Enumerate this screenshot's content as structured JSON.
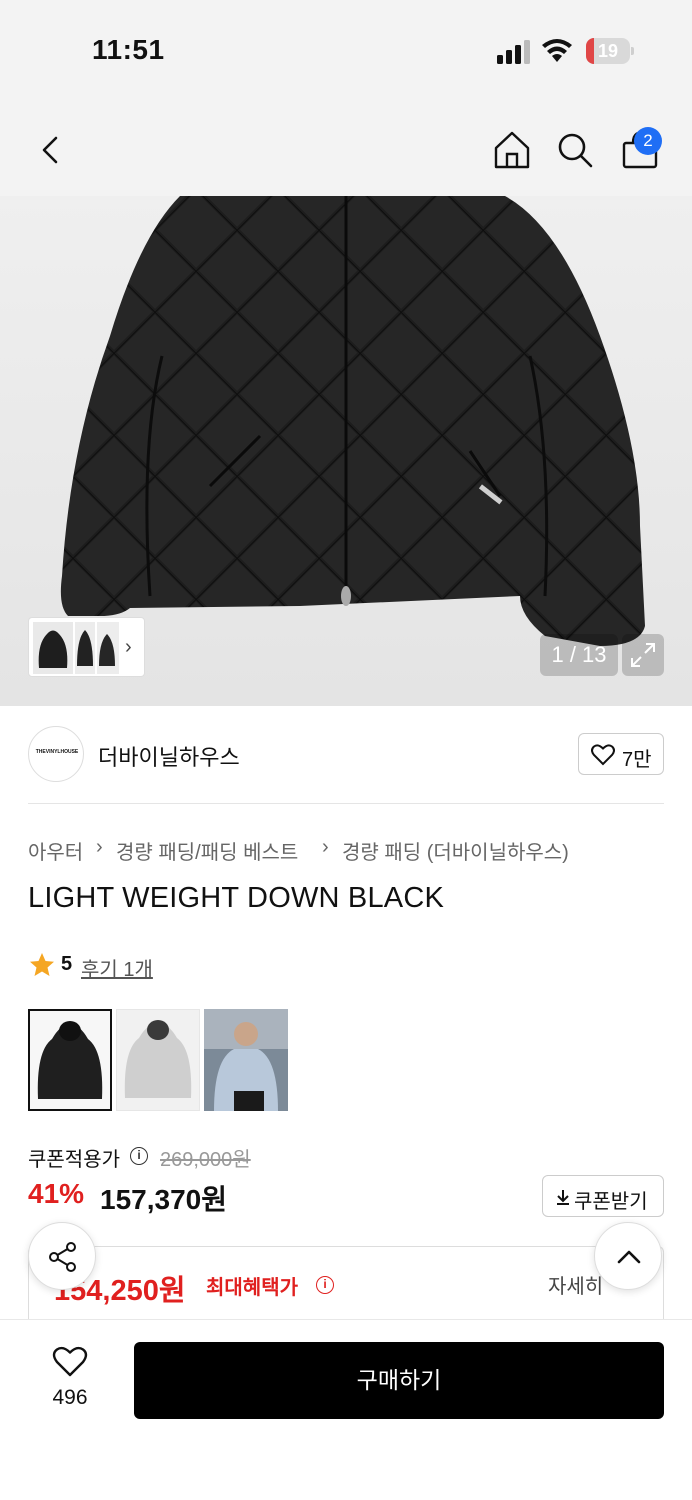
{
  "status_bar": {
    "time": "11:51",
    "battery": "19",
    "battery_level": 0.19,
    "battery_color": "#e04646"
  },
  "nav": {
    "cart_count": "2",
    "badge_color": "#1f6ef5"
  },
  "gallery": {
    "counter": "1 / 13"
  },
  "brand": {
    "logo_text": "THEVINYLHOUSE",
    "name": "더바이닐하우스",
    "followers": "7만"
  },
  "breadcrumb": [
    "아우터",
    "경량 패딩/패딩 베스트",
    "경량 패딩 (더바이닐하우스)"
  ],
  "product": {
    "title": "LIGHT WEIGHT DOWN BLACK",
    "rating": "5",
    "review_label": "후기 1개"
  },
  "price": {
    "coupon_label": "쿠폰적용가",
    "original": "269,000원",
    "discount": "41%",
    "final": "157,370원",
    "coupon_button": "쿠폰받기",
    "max_benefit_price": "154,250원",
    "max_benefit_label": "최대혜택가",
    "detail_label": "자세히",
    "accent_color": "#e0201f"
  },
  "bottom_bar": {
    "like_count": "496",
    "buy_label": "구매하기"
  }
}
